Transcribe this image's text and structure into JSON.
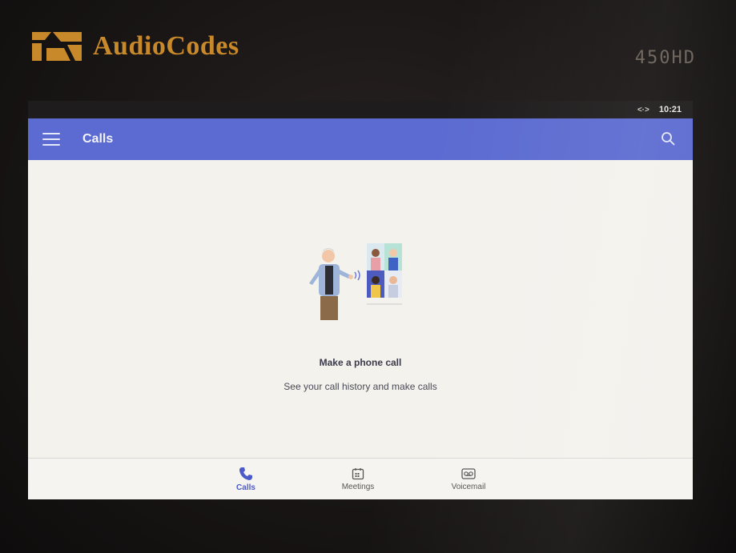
{
  "device": {
    "brand": "AudioCodes",
    "model": "450HD"
  },
  "statusbar": {
    "network_icon": "network-arrows-icon",
    "time": "10:21"
  },
  "appbar": {
    "title": "Calls",
    "menu_icon": "hamburger-menu-icon",
    "search_icon": "search-icon",
    "color": "#5c6bd1"
  },
  "empty_state": {
    "illustration": "video-call-illustration",
    "headline": "Make a phone call",
    "subline": "See your call history and make calls"
  },
  "fab": {
    "icon": "dialpad-icon",
    "color": "#4b59c9"
  },
  "bottom_nav": {
    "items": [
      {
        "label": "Calls",
        "icon": "phone-icon",
        "active": true
      },
      {
        "label": "Meetings",
        "icon": "calendar-icon",
        "active": false
      },
      {
        "label": "Voicemail",
        "icon": "voicemail-icon",
        "active": false
      }
    ],
    "active_color": "#4b59c9"
  }
}
